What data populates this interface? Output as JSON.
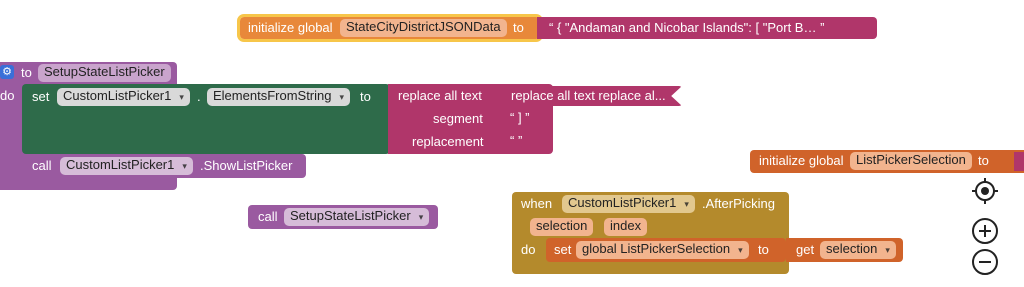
{
  "init_global_1": {
    "kw": "initialize global",
    "name": "StateCityDistrictJSONData",
    "to": "to",
    "value": "“  {   \"Andaman and Nicobar Islands\": [     \"Port B…  ”"
  },
  "procedure": {
    "gear": "⚙",
    "to": "to",
    "name": "SetupStateListPicker",
    "do": "do",
    "set": "set",
    "component": "CustomListPicker1",
    "dot": ".",
    "property": "ElementsFromString",
    "to2": "to",
    "call": "call",
    "call_component": "CustomListPicker1",
    "call_method": ".ShowListPicker"
  },
  "replace": {
    "title": "replace all text",
    "nested": "replace all text  replace al...",
    "segment": "segment",
    "segment_value": "“  ]  ”",
    "replacement": "replacement",
    "replacement_value": "“     ”"
  },
  "init_global_2": {
    "kw": "initialize global",
    "name": "ListPickerSelection",
    "to": "to"
  },
  "call_block": {
    "call": "call",
    "name": "SetupStateListPicker"
  },
  "event": {
    "when": "when",
    "component": "CustomListPicker1",
    "event": ".AfterPicking",
    "param1": "selection",
    "param2": "index",
    "do": "do",
    "set": "set",
    "var": "global ListPickerSelection",
    "to": "to",
    "get": "get",
    "get_var": "selection"
  },
  "controls": {
    "center_icon": "center-icon",
    "zoom_in_icon": "zoom-in-icon",
    "zoom_out_icon": "zoom-out-icon"
  }
}
